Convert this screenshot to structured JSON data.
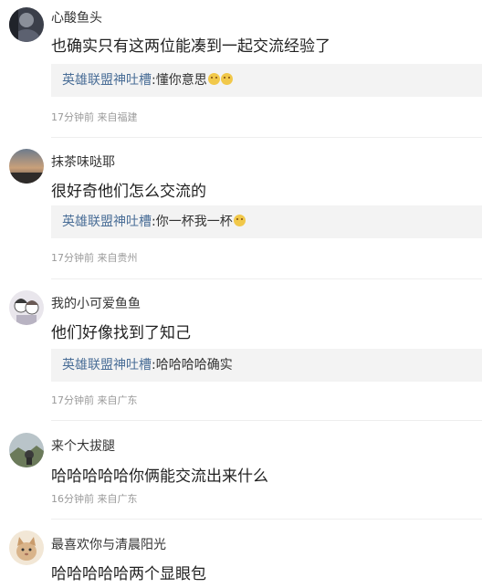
{
  "comments": [
    {
      "username": "心酸鱼头",
      "text": "也确实只有这两位能凑到一起交流经验了",
      "reply": {
        "name": "英雄联盟神吐槽",
        "colon": ":",
        "text": "懂你意思",
        "emojis": [
          "cat-emoji",
          "cat-emoji"
        ]
      },
      "time": "17分钟前",
      "location": "来自福建",
      "avatar_icon": "avatar-dark-portrait-icon"
    },
    {
      "username": "抹茶味哒耶",
      "text": "很好奇他们怎么交流的",
      "reply": {
        "name": "英雄联盟神吐槽",
        "colon": ":",
        "text": "你一杯我一杯",
        "emojis": [
          "cat-emoji"
        ]
      },
      "time": "17分钟前",
      "location": "来自贵州",
      "avatar_icon": "avatar-sunset-sky-icon"
    },
    {
      "username": "我的小可爱鱼鱼",
      "text": "他们好像找到了知己",
      "reply": {
        "name": "英雄联盟神吐槽",
        "colon": ":",
        "text": "哈哈哈哈确实",
        "emojis": []
      },
      "time": "17分钟前",
      "location": "来自广东",
      "avatar_icon": "avatar-cartoon-couple-icon"
    },
    {
      "username": "来个大拔腿",
      "text": "哈哈哈哈哈你俩能交流出来什么",
      "reply": null,
      "time": "16分钟前",
      "location": "来自广东",
      "avatar_icon": "avatar-landscape-icon"
    },
    {
      "username": "最喜欢你与清晨阳光",
      "text": "哈哈哈哈哈两个显眼包",
      "reply": null,
      "time": "",
      "location": "",
      "avatar_icon": "avatar-cat-icon"
    }
  ]
}
